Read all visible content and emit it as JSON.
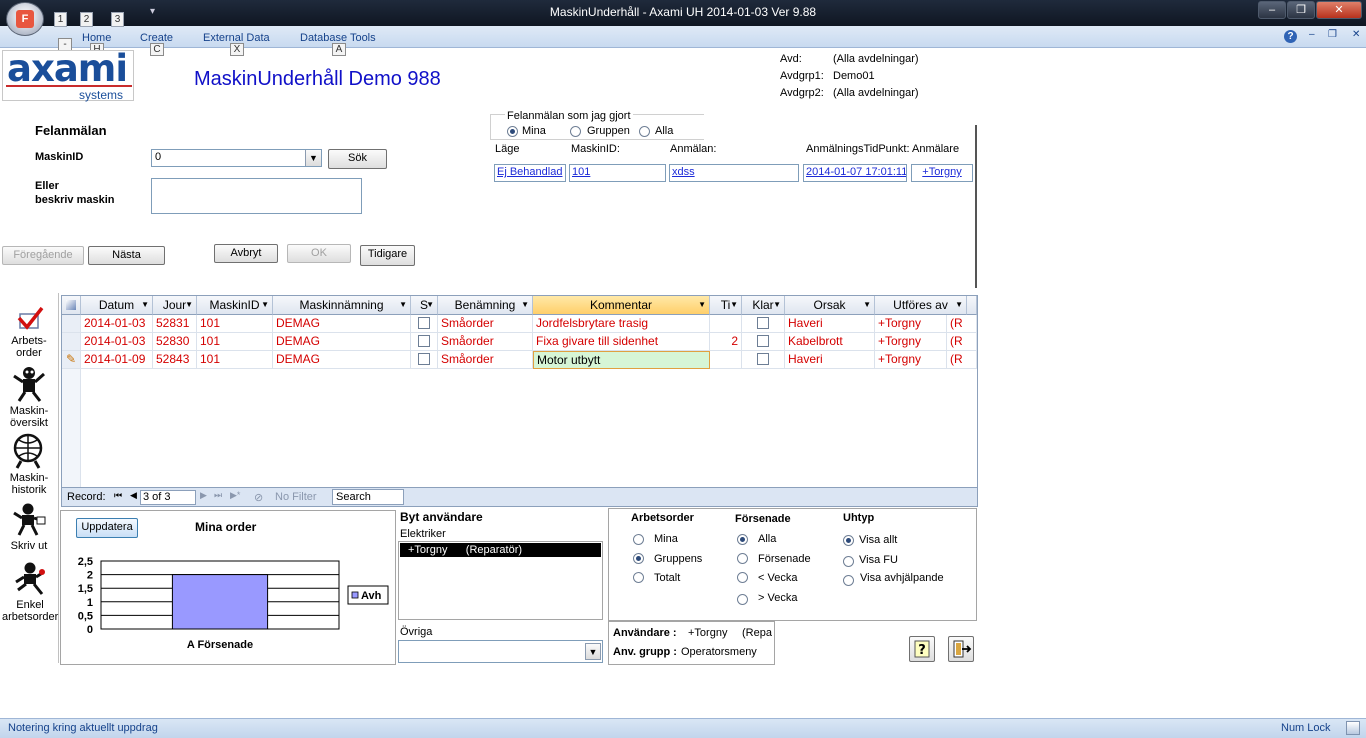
{
  "window": {
    "title": "MaskinUnderhåll - Axami UH 2014-01-03 Ver 9.88",
    "orb_letter": "F",
    "qat_keys": [
      "1",
      "2",
      "3"
    ]
  },
  "ribbon": {
    "tabs": [
      {
        "label": "Home",
        "key": "H"
      },
      {
        "label": "Create",
        "key": "C"
      },
      {
        "label": "External Data",
        "key": "X"
      },
      {
        "label": "Database Tools",
        "key": "A"
      }
    ],
    "extra_key": "-"
  },
  "header": {
    "logo_main": "axami",
    "logo_sub": "systems",
    "app_title": "MaskinUnderhåll  Demo 988",
    "avd_label": "Avd:",
    "avd_value": "(Alla avdelningar)",
    "avdgrp1_label": "Avdgrp1:",
    "avdgrp1_value": "Demo01",
    "avdgrp2_label": "Avdgrp2:",
    "avdgrp2_value": "(Alla avdelningar)"
  },
  "felanmalan": {
    "title": "Felanmälan",
    "maskinid_label": "MaskinID",
    "maskinid_value": "0",
    "sok_button": "Sök",
    "eller_label_1": "Eller",
    "eller_label_2": "beskriv maskin",
    "describe_value": "",
    "foregaende": "Föregående",
    "nasta": "Nästa",
    "avbryt": "Avbryt",
    "ok": "OK",
    "tidigare": "Tidigare"
  },
  "filter_group": {
    "title": "Felanmälan som jag gjort",
    "options": [
      "Mina",
      "Gruppen",
      "Alla"
    ],
    "selected": "Mina"
  },
  "recent": {
    "headers": [
      "Läge",
      "MaskinID:",
      "Anmälan:",
      "AnmälningsTidPunkt:",
      "Anmälare"
    ],
    "row": {
      "lage": "Ej Behandlad",
      "maskinid": "101",
      "anmalan": "xdss",
      "tidpunkt": "2014-01-07 17:01:11",
      "anmalare": "+Torgny"
    }
  },
  "sidebar": {
    "items": [
      {
        "label1": "Arbets-",
        "label2": "order"
      },
      {
        "label1": "Maskin-",
        "label2": "översikt"
      },
      {
        "label1": "Maskin-",
        "label2": "historik"
      },
      {
        "label1": "Skriv ut",
        "label2": ""
      },
      {
        "label1": "Enkel",
        "label2": "arbetsorder"
      }
    ]
  },
  "grid": {
    "columns": [
      "Datum",
      "Jour",
      "MaskinID",
      "Maskinnämning",
      "S",
      "Benämning",
      "Kommentar",
      "Ti",
      "Klar",
      "Orsak",
      "Utföres av"
    ],
    "rows": [
      {
        "datum": "2014-01-03",
        "jour": "52831",
        "maskinid": "101",
        "maskin": "DEMAG",
        "benamning": "Småorder",
        "kommentar": "Jordfelsbrytare trasig",
        "ti": "",
        "orsak": "Haveri",
        "utfores": "+Torgny",
        "extra": "(R"
      },
      {
        "datum": "2014-01-03",
        "jour": "52830",
        "maskinid": "101",
        "maskin": "DEMAG",
        "benamning": "Småorder",
        "kommentar": "Fixa givare till sidenhet",
        "ti": "2",
        "orsak": "Kabelbrott",
        "utfores": "+Torgny",
        "extra": "(R"
      },
      {
        "datum": "2014-01-09",
        "jour": "52843",
        "maskinid": "101",
        "maskin": "DEMAG",
        "benamning": "Småorder",
        "kommentar": "Motor utbytt",
        "ti": "",
        "orsak": "Haveri",
        "utfores": "+Torgny",
        "extra": "(R"
      }
    ],
    "nav": {
      "record_label": "Record:",
      "position": "3 of 3",
      "no_filter": "No Filter",
      "search": "Search"
    }
  },
  "chart_panel": {
    "update_button": "Uppdatera",
    "title": "Mina order",
    "legend": "Avh"
  },
  "chart_data": {
    "type": "bar",
    "categories": [
      "A Försenade"
    ],
    "series": [
      {
        "name": "Avh",
        "values": [
          2
        ]
      }
    ],
    "yticks": [
      "2,5",
      "2",
      "1,5",
      "1",
      "0,5",
      "0"
    ],
    "ylim": [
      0,
      2.5
    ],
    "grid": true,
    "legend_position": "right",
    "bar_color": "#9999ff"
  },
  "users_panel": {
    "title": "Byt användare",
    "group_label": "Elektriker",
    "selected_user": "+Torgny      (Reparatör)",
    "ovriga_label": "Övriga",
    "ovriga_value": ""
  },
  "options_panel": {
    "arbetsorder": {
      "title": "Arbetsorder",
      "options": [
        "Mina",
        "Gruppens",
        "Totalt"
      ],
      "selected": "Gruppens"
    },
    "forsenade": {
      "title": "Försenade",
      "options": [
        "Alla",
        "Försenade",
        "< Vecka",
        "> Vecka"
      ],
      "selected": "Alla"
    },
    "uhtyp": {
      "title": "Uhtyp",
      "options": [
        "Visa allt",
        "Visa FU",
        "Visa avhjälpande"
      ],
      "selected": "Visa allt"
    }
  },
  "user_info": {
    "anvandare_label": "Användare :",
    "anvandare_value": "+Torgny",
    "anvandare_role": "(Repa",
    "grupp_label": "Anv. grupp :",
    "grupp_value": "Operatorsmeny"
  },
  "statusbar": {
    "left": "Notering kring aktuellt uppdrag",
    "right": "Num Lock"
  },
  "colors": {
    "accent_blue": "#1010c8",
    "record_red": "#d40000",
    "link_blue": "#1c2ad8"
  }
}
